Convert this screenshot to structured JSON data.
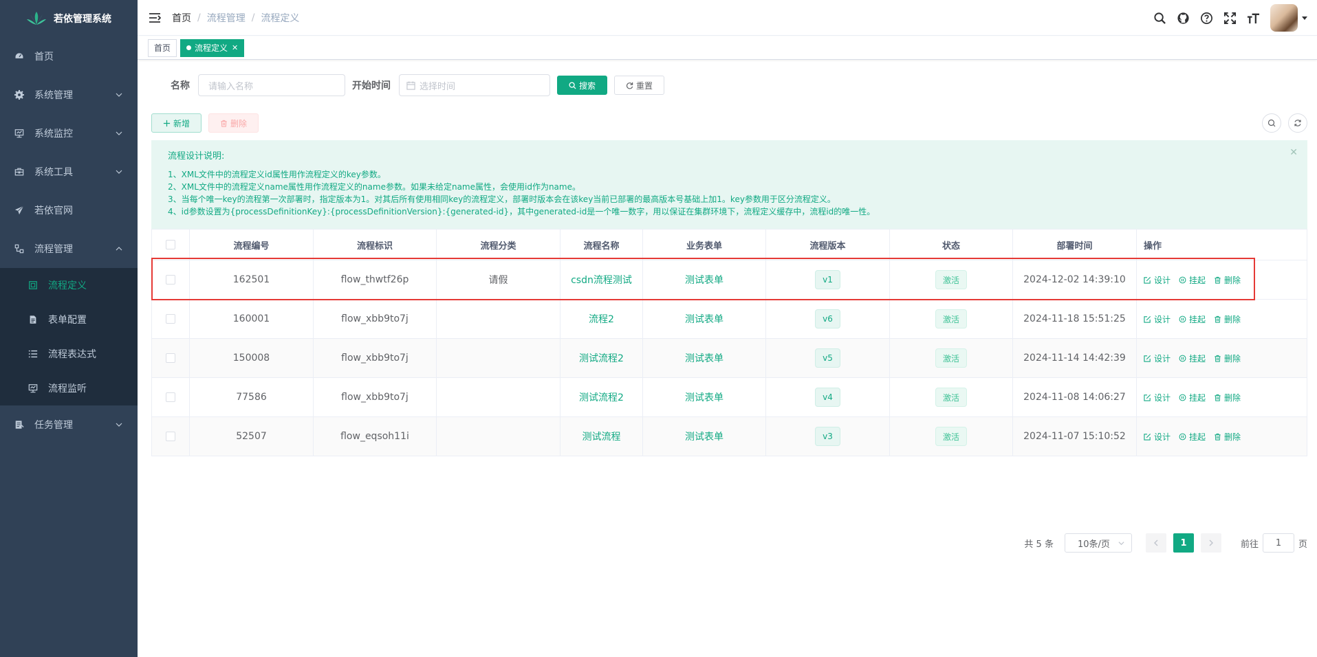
{
  "app": {
    "title": "若依管理系统"
  },
  "sidebar": {
    "items": [
      {
        "label": "首页",
        "icon": "dashboard-icon"
      },
      {
        "label": "系统管理",
        "icon": "gear-icon"
      },
      {
        "label": "系统监控",
        "icon": "monitor-icon"
      },
      {
        "label": "系统工具",
        "icon": "toolbox-icon"
      },
      {
        "label": "若依官网",
        "icon": "paper-plane-icon"
      },
      {
        "label": "流程管理",
        "icon": "flow-icon"
      },
      {
        "label": "任务管理",
        "icon": "tasks-icon"
      }
    ],
    "flow_sub": [
      {
        "label": "流程定义",
        "icon": "definition-icon"
      },
      {
        "label": "表单配置",
        "icon": "form-icon"
      },
      {
        "label": "流程表达式",
        "icon": "list-icon"
      },
      {
        "label": "流程监听",
        "icon": "monitor-icon"
      }
    ]
  },
  "breadcrumb": [
    "首页",
    "流程管理",
    "流程定义"
  ],
  "tags": {
    "home": "首页",
    "current": "流程定义"
  },
  "search": {
    "name_label": "名称",
    "name_placeholder": "请输入名称",
    "time_label": "开始时间",
    "time_placeholder": "选择时间",
    "search_btn": "搜索",
    "reset_btn": "重置"
  },
  "toolbar": {
    "add": "新增",
    "delete": "删除"
  },
  "alert": {
    "title": "流程设计说明:",
    "lines": [
      "1、XML文件中的流程定义id属性用作流程定义的key参数。",
      "2、XML文件中的流程定义name属性用作流程定义的name参数。如果未给定name属性，会使用id作为name。",
      "3、当每个唯一key的流程第一次部署时，指定版本为1。对其后所有使用相同key的流程定义，部署时版本会在该key当前已部署的最高版本号基础上加1。key参数用于区分流程定义。",
      "4、id参数设置为{processDefinitionKey}:{processDefinitionVersion}:{generated-id}，其中generated-id是一个唯一数字，用以保证在集群环境下，流程定义缓存中，流程id的唯一性。"
    ]
  },
  "table": {
    "headers": [
      "流程编号",
      "流程标识",
      "流程分类",
      "流程名称",
      "业务表单",
      "流程版本",
      "状态",
      "部署时间",
      "操作"
    ],
    "rows": [
      {
        "id": "162501",
        "key": "flow_thwtf26p",
        "category": "请假",
        "name": "csdn流程测试",
        "form": "测试表单",
        "version": "v1",
        "status": "激活",
        "time": "2024-12-02 14:39:10"
      },
      {
        "id": "160001",
        "key": "flow_xbb9to7j",
        "category": "",
        "name": "流程2",
        "form": "测试表单",
        "version": "v6",
        "status": "激活",
        "time": "2024-11-18 15:51:25"
      },
      {
        "id": "150008",
        "key": "flow_xbb9to7j",
        "category": "",
        "name": "测试流程2",
        "form": "测试表单",
        "version": "v5",
        "status": "激活",
        "time": "2024-11-14 14:42:39"
      },
      {
        "id": "77586",
        "key": "flow_xbb9to7j",
        "category": "",
        "name": "测试流程2",
        "form": "测试表单",
        "version": "v4",
        "status": "激活",
        "time": "2024-11-08 14:06:27"
      },
      {
        "id": "52507",
        "key": "flow_eqsoh11i",
        "category": "",
        "name": "测试流程",
        "form": "测试表单",
        "version": "v3",
        "status": "激活",
        "time": "2024-11-07 15:10:52"
      }
    ],
    "ops": {
      "design": "设计",
      "suspend": "挂起",
      "delete": "删除"
    }
  },
  "pagination": {
    "total_text": "共 5 条",
    "page_size": "10条/页",
    "current_page": "1",
    "goto_label": "前往",
    "goto_value": "1",
    "page_suffix": "页"
  },
  "colors": {
    "accent": "#11a983",
    "sidebar_bg": "#304156",
    "submenu_bg": "#1f2d3d",
    "highlight": "#e53935"
  }
}
